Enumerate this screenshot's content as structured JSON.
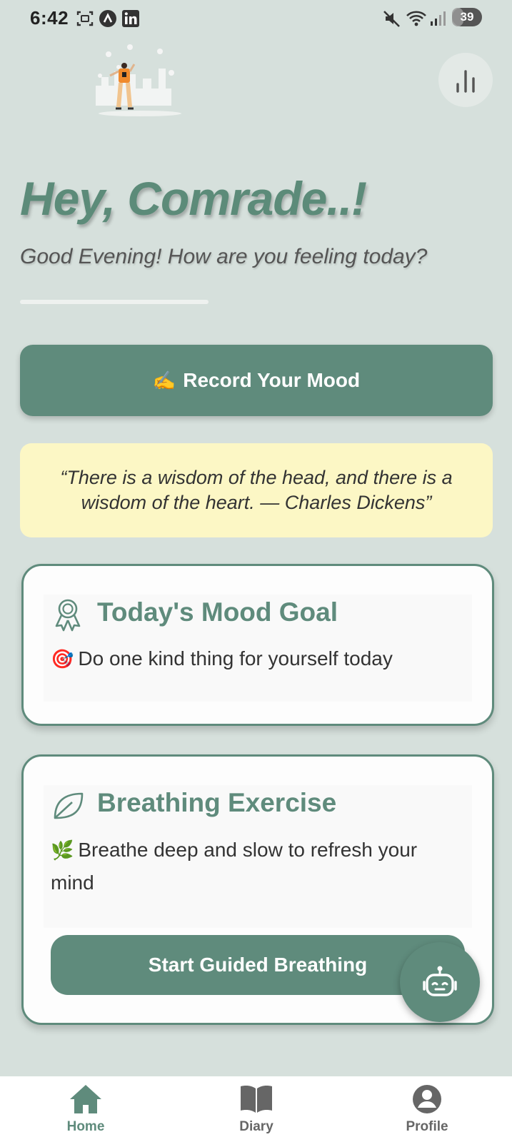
{
  "status_bar": {
    "time": "6:42",
    "battery": "39",
    "battery_level": 0.39,
    "left_icons": [
      "screenshot-icon",
      "app-a-icon",
      "linkedin-icon"
    ],
    "right_icons": [
      "mute-icon",
      "wifi-icon",
      "signal-icon",
      "battery-icon"
    ]
  },
  "header": {
    "stats_icon": "bar-chart-icon"
  },
  "greeting": {
    "title": "Hey, Comrade..!",
    "subtitle": "Good Evening! How are you feeling today?"
  },
  "record_button": {
    "emoji": "✍️",
    "label": "Record Your Mood"
  },
  "quote": {
    "text": "“There is a wisdom of the head, and there is a wisdom of the heart. — Charles Dickens”"
  },
  "mood_goal": {
    "icon": "award-ribbon-icon",
    "title": "Today's Mood Goal",
    "emoji": "🎯",
    "text": "Do one kind thing for yourself today"
  },
  "breathing": {
    "icon": "leaf-icon",
    "title": "Breathing Exercise",
    "emoji": "🌿",
    "text": "Breathe deep and slow to refresh your mind",
    "button": "Start Guided Breathing"
  },
  "fab": {
    "icon": "robot-chat-icon"
  },
  "bottom_nav": {
    "items": [
      {
        "label": "Home",
        "icon": "home-icon",
        "active": true
      },
      {
        "label": "Diary",
        "icon": "book-icon",
        "active": false
      },
      {
        "label": "Profile",
        "icon": "user-icon",
        "active": false
      }
    ]
  },
  "colors": {
    "background": "#d6e0dc",
    "accent": "#5f8b7c",
    "quote_bg": "#fcf7c5",
    "nav_inactive": "#666666"
  }
}
